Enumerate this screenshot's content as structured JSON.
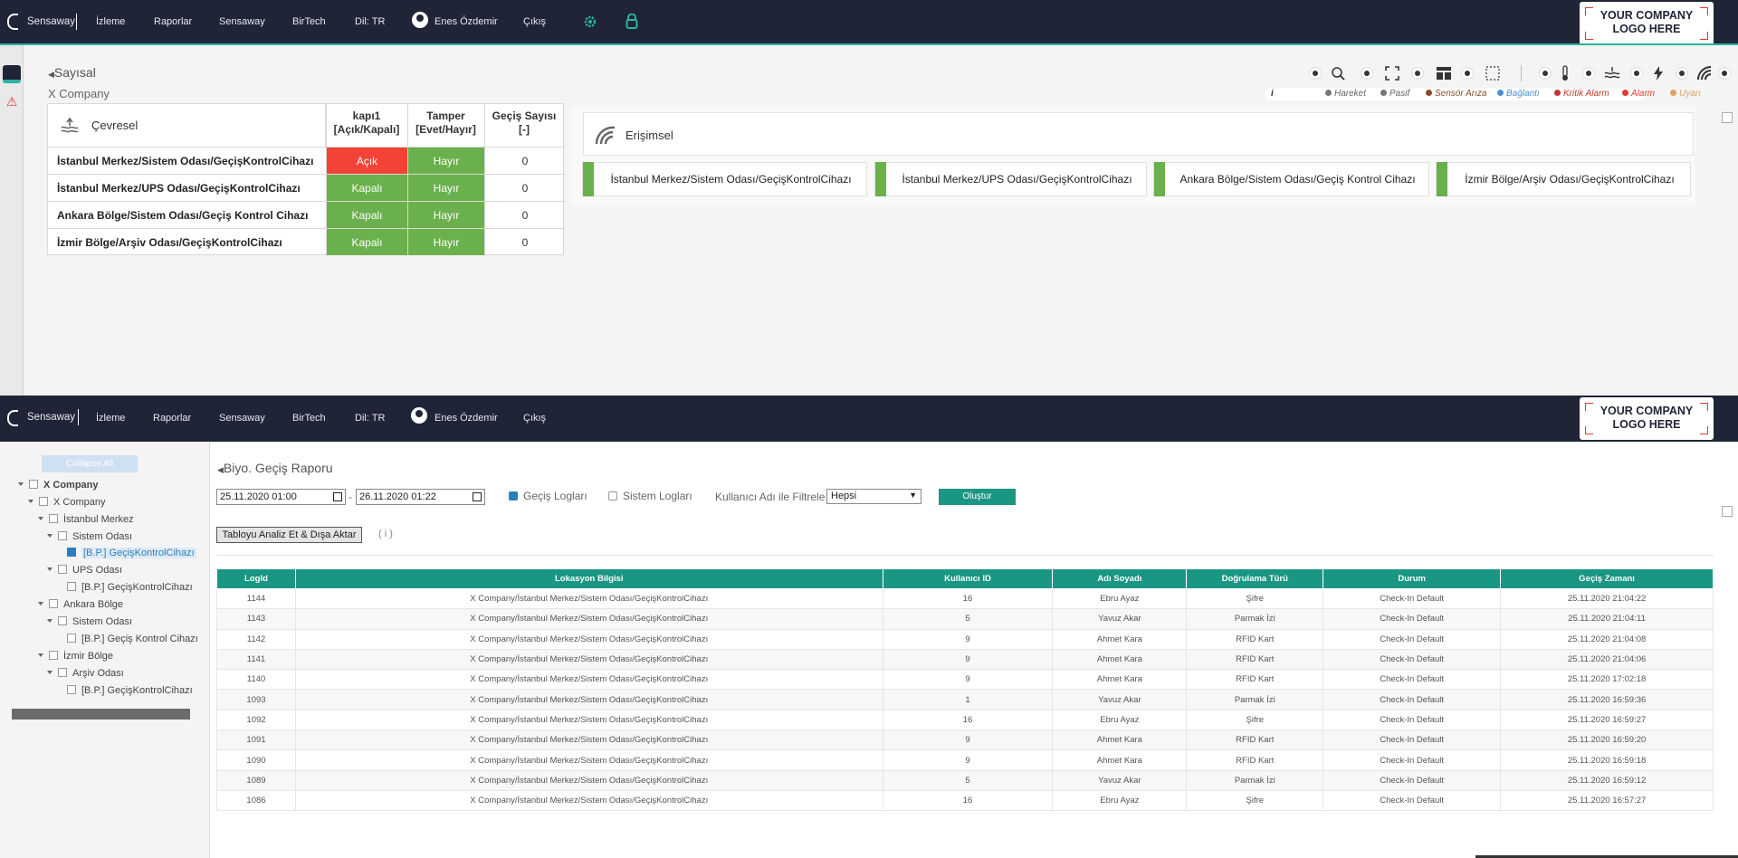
{
  "nav": {
    "brand": "Sensaway",
    "items": [
      "İzleme",
      "Raporlar",
      "Sensaway",
      "BirTech",
      "Dil: TR"
    ],
    "user": "Enes Özdemir",
    "logout": "Çıkış",
    "company_logo_line1": "YOUR COMPANY",
    "company_logo_line2": "LOGO HERE",
    "accent": "#2bb3a3",
    "bg": "#1f2537"
  },
  "top": {
    "breadcrumb": "Sayısal",
    "company": "X Company",
    "env_title": "Çevresel",
    "col_kapi": "kapı1",
    "col_kapi_sub": "[Açık/Kapalı]",
    "col_tamper": "Tamper",
    "col_tamper_sub": "[Evet/Hayır]",
    "col_gecis": "Geçiş Sayısı",
    "col_gecis_sub": "[-]",
    "rows": [
      {
        "name": "İstanbul Merkez/Sistem Odası/GeçişKontrolCihazı",
        "kapi": "Açık",
        "tamper": "Hayır",
        "gecis": "0"
      },
      {
        "name": "İstanbul Merkez/UPS Odası/GeçişKontrolCihazı",
        "kapi": "Kapalı",
        "tamper": "Hayır",
        "gecis": "0"
      },
      {
        "name": "Ankara Bölge/Sistem Odası/Geçiş Kontrol Cihazı",
        "kapi": "Kapalı",
        "tamper": "Hayır",
        "gecis": "0"
      },
      {
        "name": "İzmir Bölge/Arşiv Odası/GeçişKontrolCihazı",
        "kapi": "Kapalı",
        "tamper": "Hayır",
        "gecis": "0"
      }
    ],
    "eri_title": "Erişimsel",
    "eri_devices": [
      "İstanbul Merkez/Sistem Odası/GeçişKontrolCihazı",
      "İstanbul Merkez/UPS Odası/GeçişKontrolCihazı",
      "Ankara Bölge/Sistem Odası/Geçiş Kontrol Cihazı",
      "İzmir Bölge/Arşiv Odası/GeçişKontrolCihazı"
    ],
    "legend": [
      {
        "label": "Hareket",
        "color": "#777777"
      },
      {
        "label": "Pasif",
        "color": "#777777"
      },
      {
        "label": "Sensör Arıza",
        "color": "#8a4b2a"
      },
      {
        "label": "Bağlantı",
        "color": "#4a90d9"
      },
      {
        "label": "Kritik Alarm",
        "color": "#c0392b"
      },
      {
        "label": "Alarm",
        "color": "#e53935"
      },
      {
        "label": "Uyarı",
        "color": "#e0a060"
      }
    ],
    "legend_info": "i"
  },
  "bottom": {
    "collapse_all": "Collapse All",
    "tree": [
      {
        "label": "X Company",
        "bold": true,
        "checked": false
      },
      {
        "label": "X Company",
        "bold": false,
        "checked": false
      },
      {
        "label": "İstanbul Merkez",
        "bold": false,
        "checked": false
      },
      {
        "label": "Sistem Odası",
        "bold": false,
        "checked": false
      },
      {
        "label": "[B.P.] GeçişKontrolCihazı",
        "bold": false,
        "checked": true
      },
      {
        "label": "UPS Odası",
        "bold": false,
        "checked": false
      },
      {
        "label": "[B.P.] GeçişKontrolCihazı",
        "bold": false,
        "checked": false
      },
      {
        "label": "Ankara Bölge",
        "bold": false,
        "checked": false
      },
      {
        "label": "Sistem Odası",
        "bold": false,
        "checked": false
      },
      {
        "label": "[B.P.] Geçiş Kontrol Cihazı",
        "bold": false,
        "checked": false
      },
      {
        "label": "İzmir Bölge",
        "bold": false,
        "checked": false
      },
      {
        "label": "Arşiv Odası",
        "bold": false,
        "checked": false
      },
      {
        "label": "[B.P.] GeçişKontrolCihazı",
        "bold": false,
        "checked": false
      }
    ],
    "report_title": "Biyo. Geçiş Raporu",
    "date_from": "25.11.2020 01:00",
    "date_to": "26.11.2020 01:22",
    "date_sep": "-",
    "gecis_loglari": "Geçiş Logları",
    "sistem_loglari": "Sistem Logları",
    "filter_label": "Kullanıcı Adı ile Filtrele",
    "filter_value": "Hepsi",
    "olustur": "Oluştur",
    "analyze_btn": "Tabloyu Analiz Et & Dışa Aktar",
    "info": "( i )",
    "columns": [
      "LogId",
      "Lokasyon Bilgisi",
      "Kullanıcı ID",
      "Adı Soyadı",
      "Doğrulama Türü",
      "Durum",
      "Geçiş Zamanı"
    ],
    "rows": [
      [
        "1144",
        "X Company/İstanbul Merkez/Sistem Odası/GeçişKontrolCihazı",
        "16",
        "Ebru Ayaz",
        "Şifre",
        "Check-In Default",
        "25.11.2020 21:04:22"
      ],
      [
        "1143",
        "X Company/İstanbul Merkez/Sistem Odası/GeçişKontrolCihazı",
        "5",
        "Yavuz Akar",
        "Parmak İzi",
        "Check-In Default",
        "25.11.2020 21:04:11"
      ],
      [
        "1142",
        "X Company/İstanbul Merkez/Sistem Odası/GeçişKontrolCihazı",
        "9",
        "Ahmet Kara",
        "RFID Kart",
        "Check-In Default",
        "25.11.2020 21:04:08"
      ],
      [
        "1141",
        "X Company/İstanbul Merkez/Sistem Odası/GeçişKontrolCihazı",
        "9",
        "Ahmet Kara",
        "RFID Kart",
        "Check-In Default",
        "25.11.2020 21:04:06"
      ],
      [
        "1140",
        "X Company/İstanbul Merkez/Sistem Odası/GeçişKontrolCihazı",
        "9",
        "Ahmet Kara",
        "RFID Kart",
        "Check-In Default",
        "25.11.2020 17:02:18"
      ],
      [
        "1093",
        "X Company/İstanbul Merkez/Sistem Odası/GeçişKontrolCihazı",
        "1",
        "Yavuz Akar",
        "Parmak İzi",
        "Check-In Default",
        "25.11.2020 16:59:36"
      ],
      [
        "1092",
        "X Company/İstanbul Merkez/Sistem Odası/GeçişKontrolCihazı",
        "16",
        "Ebru Ayaz",
        "Şifre",
        "Check-In Default",
        "25.11.2020 16:59:27"
      ],
      [
        "1091",
        "X Company/İstanbul Merkez/Sistem Odası/GeçişKontrolCihazı",
        "9",
        "Ahmet Kara",
        "RFID Kart",
        "Check-In Default",
        "25.11.2020 16:59:20"
      ],
      [
        "1090",
        "X Company/İstanbul Merkez/Sistem Odası/GeçişKontrolCihazı",
        "9",
        "Ahmet Kara",
        "RFID Kart",
        "Check-In Default",
        "25.11.2020 16:59:18"
      ],
      [
        "1089",
        "X Company/İstanbul Merkez/Sistem Odası/GeçişKontrolCihazı",
        "5",
        "Yavuz Akar",
        "Parmak İzi",
        "Check-In Default",
        "25.11.2020 16:59:12"
      ],
      [
        "1086",
        "X Company/İstanbul Merkez/Sistem Odası/GeçişKontrolCihazı",
        "16",
        "Ebru Ayaz",
        "Şifre",
        "Check-In Default",
        "25.11.2020 16:57:27"
      ]
    ],
    "header_color": "#1a9783"
  }
}
